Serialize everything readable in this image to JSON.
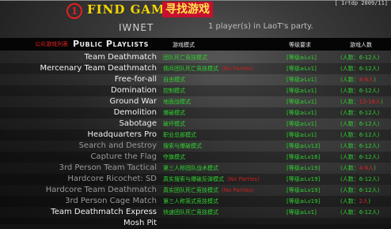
{
  "top_info": "[ 1rtdp 2009/11]",
  "header": {
    "step_number": "1",
    "title_en": "FIND GAME",
    "title_cn": "寻找游戏",
    "network": "IWNET",
    "party_status": "1 player(s) in LaoT's party."
  },
  "table_header": {
    "tag": "公众游戏列表",
    "title": "Public Playlists",
    "col_mode": "游戏模式",
    "col_req": "等级要求",
    "col_players": "游戏人数"
  },
  "playlists": [
    {
      "name": "Team Deathmatch",
      "desc": "团队死亡竞技模式",
      "note": "",
      "req": "[等级≥Lv1]",
      "count": "(人数：6-12人)",
      "count_special": "",
      "dim": false
    },
    {
      "name": "Mercenary Team Deathmatch",
      "desc": "佣兵团队死亡竞技模式",
      "note": "(No Parties)",
      "req": "[等级≥Lv1]",
      "count": "(人数：6-12人)",
      "count_special": "",
      "dim": false
    },
    {
      "name": "Free-for-all",
      "desc": "自由模式",
      "note": "",
      "req": "[等级≥Lv1]",
      "count": "(人数：",
      "count_special": "4-8人",
      "dim": false
    },
    {
      "name": "Domination",
      "desc": "控制模式",
      "note": "",
      "req": "[等级≥Lv1]",
      "count": "(人数：6-12人)",
      "count_special": "",
      "dim": false
    },
    {
      "name": "Ground War",
      "desc": "地面战模式",
      "note": "",
      "req": "[等级≥Lv1]",
      "count": "(人数：",
      "count_special": "12-18人",
      "dim": false
    },
    {
      "name": "Demolition",
      "desc": "爆破模式",
      "note": "",
      "req": "[等级≥Lv1]",
      "count": "(人数：6-12人)",
      "count_special": "",
      "dim": false
    },
    {
      "name": "Sabotage",
      "desc": "破坏模式",
      "note": "",
      "req": "[等级≥Lv1]",
      "count": "(人数：6-12人)",
      "count_special": "",
      "dim": false
    },
    {
      "name": "Headquarters Pro",
      "desc": "职业总部模式",
      "note": "",
      "req": "[等级≥Lv1]",
      "count": "(人数：6-12人)",
      "count_special": "",
      "dim": false
    },
    {
      "name": "Search and Destroy",
      "desc": "搜索与爆破模式",
      "note": "",
      "req": "[等级≥Lv13]",
      "count": "(人数：6-12人)",
      "count_special": "",
      "dim": true
    },
    {
      "name": "Capture the Flag",
      "desc": "夺旗模式",
      "note": "",
      "req": "[等级≥Lv16]",
      "count": "(人数：6-12人)",
      "count_special": "",
      "dim": true
    },
    {
      "name": "3rd Person Team Tactical",
      "desc": "第三人称团队战术模式",
      "note": "",
      "req": "[等级≥Lv19]",
      "count": "(人数：",
      "count_special": "4-8人",
      "dim": true
    },
    {
      "name": "Hardcore Ricochet: SD",
      "desc": "真实搜索与爆破反弹模式",
      "note": "(No Parties)",
      "req": "[等级≥Lv19]",
      "count": "(人数：6-12人)",
      "count_special": "",
      "dim": true
    },
    {
      "name": "Hardcore Team Deathmatch",
      "desc": "真实团队死亡竞技模式",
      "note": "(No Parties)",
      "req": "[等级≥Lv19]",
      "count": "(人数：6-12人)",
      "count_special": "",
      "dim": true
    },
    {
      "name": "3rd Person Cage Match",
      "desc": "第三人称笼式竞技模式",
      "note": "",
      "req": "[等级≥Lv19]",
      "count": "(人数：",
      "count_special": "2人",
      "dim": true
    },
    {
      "name": "Team Deathmatch Express",
      "desc": "快速团队死亡竞技模式",
      "note": "",
      "req": "[等级≥Lv1]",
      "count": "(人数：6-12人)",
      "count_special": "",
      "dim": false
    },
    {
      "name": "Mosh Pit",
      "desc": "",
      "note": "",
      "req": "",
      "count": "",
      "count_special": "",
      "dim": false
    }
  ]
}
